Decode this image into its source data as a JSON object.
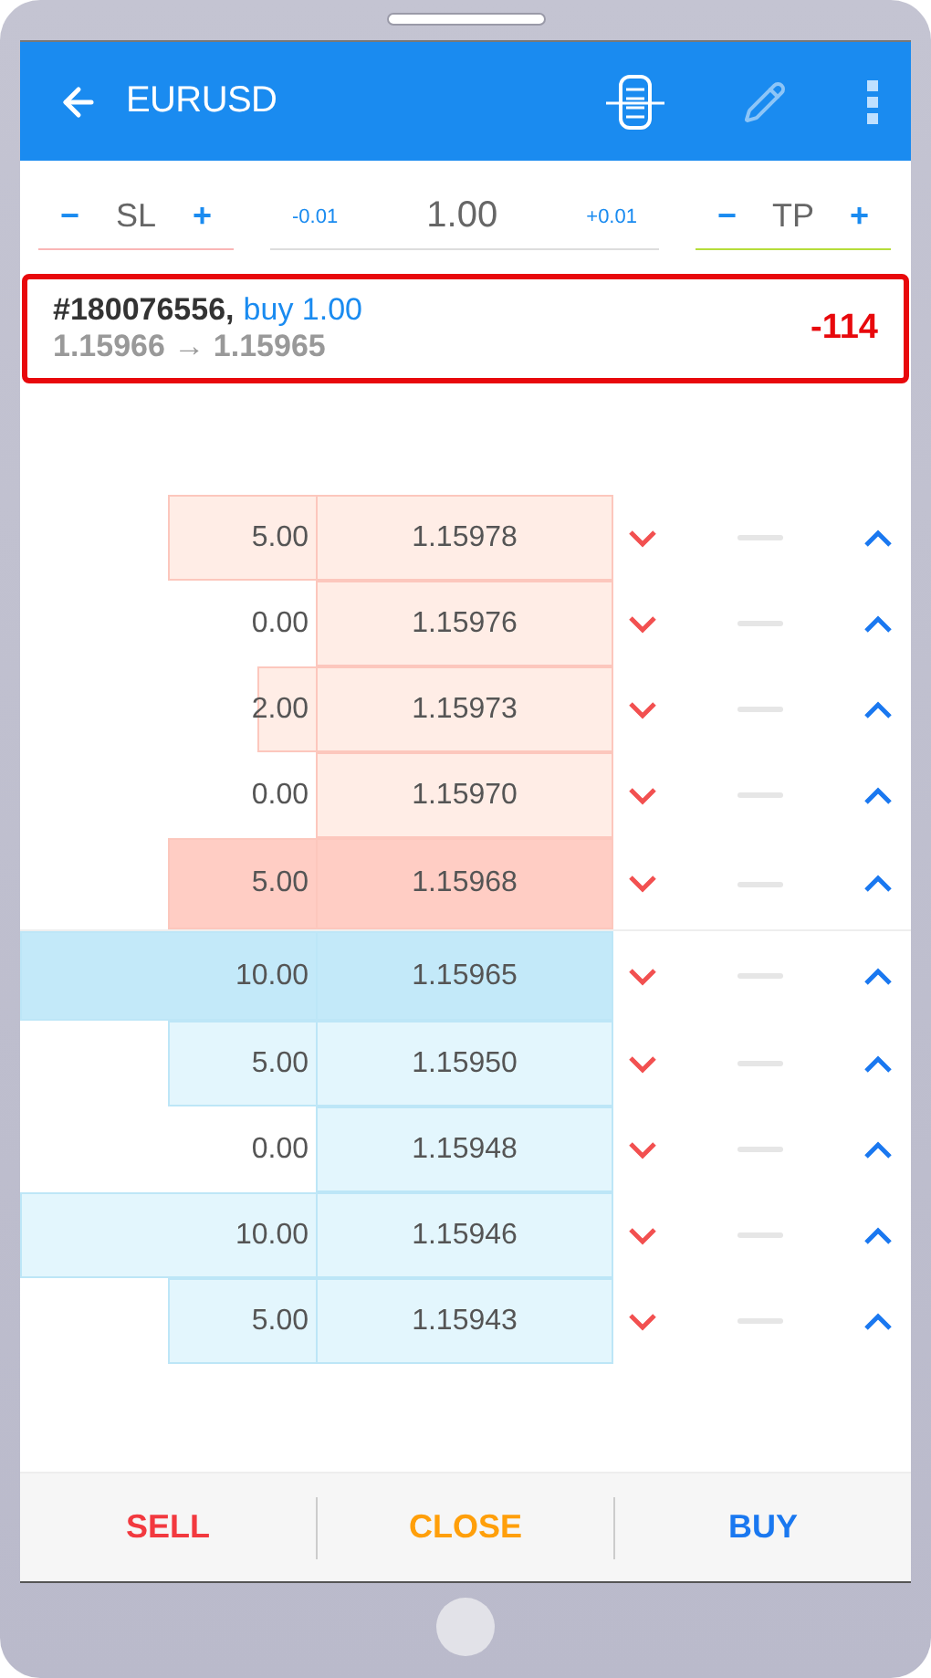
{
  "header": {
    "title": "EURUSD"
  },
  "controls": {
    "sl": {
      "minus": "−",
      "label": "SL",
      "plus": "+"
    },
    "volume": {
      "minus": "-0.01",
      "value": "1.00",
      "plus": "+0.01"
    },
    "tp": {
      "minus": "−",
      "label": "TP",
      "plus": "+"
    }
  },
  "position": {
    "ticket": "#180076556,",
    "trade": "buy 1.00",
    "prices": "1.15966 → 1.15965",
    "profit": "-114"
  },
  "book": [
    {
      "kind": "ask",
      "volume": "5.00",
      "price": "1.15978",
      "best": false
    },
    {
      "kind": "ask",
      "volume": "0.00",
      "price": "1.15976",
      "best": false
    },
    {
      "kind": "ask",
      "volume": "2.00",
      "price": "1.15973",
      "best": false
    },
    {
      "kind": "ask",
      "volume": "0.00",
      "price": "1.15970",
      "best": false
    },
    {
      "kind": "ask",
      "volume": "5.00",
      "price": "1.15968",
      "best": true
    },
    {
      "kind": "bid",
      "volume": "10.00",
      "price": "1.15965",
      "best": true
    },
    {
      "kind": "bid",
      "volume": "5.00",
      "price": "1.15950",
      "best": false
    },
    {
      "kind": "bid",
      "volume": "0.00",
      "price": "1.15948",
      "best": false
    },
    {
      "kind": "bid",
      "volume": "10.00",
      "price": "1.15946",
      "best": false
    },
    {
      "kind": "bid",
      "volume": "5.00",
      "price": "1.15943",
      "best": false
    }
  ],
  "actions": [
    {
      "label": "SELL",
      "kind": "sell"
    },
    {
      "label": "CLOSE",
      "kind": "close"
    },
    {
      "label": "BUY",
      "kind": "buy"
    }
  ]
}
